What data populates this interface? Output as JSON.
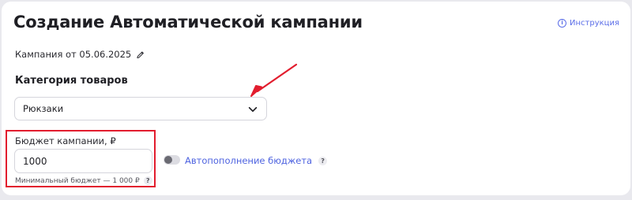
{
  "page": {
    "title": "Создание Автоматической кампании",
    "instruction_link": "Инструкция",
    "campaign_name": "Кампания от 05.06.2025"
  },
  "category": {
    "label": "Категория товаров",
    "selected": "Рюкзаки"
  },
  "budget": {
    "label": "Бюджет кампании, ₽",
    "value": "1000",
    "min_hint": "Минимальный бюджет — 1 000 ₽",
    "help": "?"
  },
  "autofill": {
    "label": "Автопополнение бюджета",
    "enabled": false,
    "help": "?"
  },
  "icons": {
    "info": "info-icon",
    "edit": "pencil-icon",
    "dropdown": "chevron-down-icon",
    "annotation": "red-arrow-annotation"
  },
  "colors": {
    "accent": "#4e63e0",
    "annotation": "#e21d2e",
    "background": "#e9e9ee",
    "card": "#ffffff"
  }
}
